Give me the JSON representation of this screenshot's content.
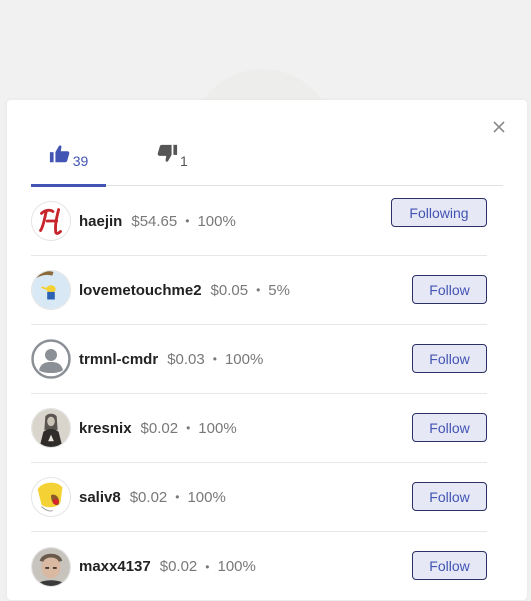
{
  "modal": {
    "close_icon": "close-icon",
    "tabs": [
      {
        "icon": "thumbs-up-icon",
        "count": "39",
        "active": true
      },
      {
        "icon": "thumbs-down-icon",
        "count": "1",
        "active": false
      }
    ]
  },
  "colors": {
    "accent": "#4254b4",
    "button_bg": "#e6e8f5",
    "button_border": "#2c3165",
    "muted_text": "#787878"
  },
  "voters": [
    {
      "username": "haejin",
      "amount": "$54.65",
      "separator": "•",
      "percent": "100%",
      "button": "Following"
    },
    {
      "username": "lovemetouchme2",
      "amount": "$0.05",
      "separator": "•",
      "percent": "5%",
      "button": "Follow"
    },
    {
      "username": "trmnl-cmdr",
      "amount": "$0.03",
      "separator": "•",
      "percent": "100%",
      "button": "Follow"
    },
    {
      "username": "kresnix",
      "amount": "$0.02",
      "separator": "•",
      "percent": "100%",
      "button": "Follow"
    },
    {
      "username": "saliv8",
      "amount": "$0.02",
      "separator": "•",
      "percent": "100%",
      "button": "Follow"
    },
    {
      "username": "maxx4137",
      "amount": "$0.02",
      "separator": "•",
      "percent": "100%",
      "button": "Follow"
    }
  ]
}
